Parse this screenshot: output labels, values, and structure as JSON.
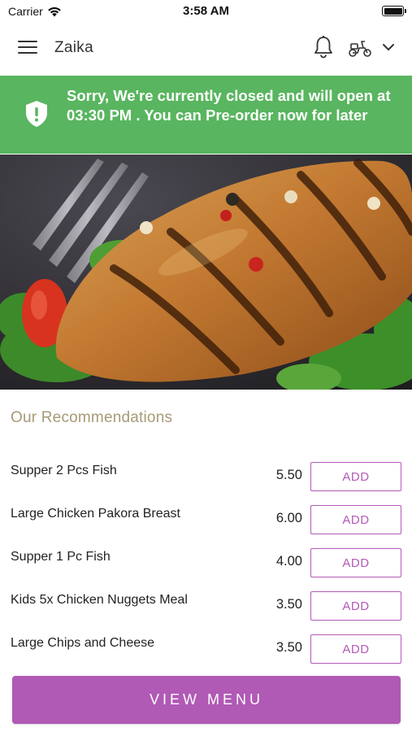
{
  "status_bar": {
    "carrier": "Carrier",
    "time": "3:58 AM"
  },
  "nav": {
    "title": "Zaika",
    "icons": [
      "menu-icon",
      "bell-icon",
      "scooter-icon",
      "chevron-down-icon"
    ]
  },
  "banner": {
    "message": "Sorry, We're currently closed and will open at 03:30 PM . You can Pre-order now for later",
    "icon": "shield-alert-icon",
    "color": "#59b55f"
  },
  "recommendations": {
    "title": "Our Recommendations",
    "items": [
      {
        "name": "Supper 2 Pcs Fish",
        "price": "5.50",
        "action": "ADD"
      },
      {
        "name": "Large Chicken Pakora Breast",
        "price": "6.00",
        "action": "ADD"
      },
      {
        "name": "Supper 1 Pc Fish",
        "price": "4.00",
        "action": "ADD"
      },
      {
        "name": "Kids 5x Chicken Nuggets Meal",
        "price": "3.50",
        "action": "ADD"
      },
      {
        "name": "Large Chips and Cheese",
        "price": "3.50",
        "action": "ADD"
      }
    ]
  },
  "view_menu_label": "VIEW MENU",
  "colors": {
    "accent": "#b059b5",
    "banner": "#59b55f",
    "section_title": "#a79a76"
  }
}
